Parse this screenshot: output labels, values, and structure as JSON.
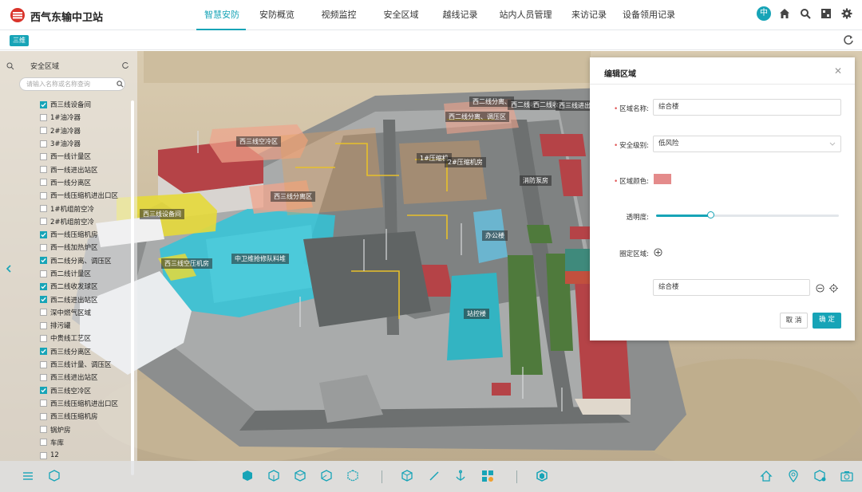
{
  "app": {
    "title": "西气东输中卫站"
  },
  "nav": {
    "items": [
      "智慧安防",
      "安防概览",
      "视频监控",
      "安全区域",
      "越线记录",
      "站内人员管理",
      "来访记录",
      "设备领用记录"
    ],
    "active": 0
  },
  "toolbar": {
    "lang": "中",
    "icons": [
      "home-icon",
      "search-icon",
      "fullscreen-icon",
      "settings-icon"
    ]
  },
  "subbar": {
    "mode_button": "三维"
  },
  "sidebar": {
    "title": "安全区域",
    "search_placeholder": "请输入名称或名称查询",
    "items": [
      {
        "label": "西三线设备间",
        "checked": true
      },
      {
        "label": "1#油冷器",
        "checked": false
      },
      {
        "label": "2#油冷器",
        "checked": false
      },
      {
        "label": "3#油冷器",
        "checked": false
      },
      {
        "label": "西一线计量区",
        "checked": false
      },
      {
        "label": "西一线进出站区",
        "checked": false
      },
      {
        "label": "西一线分离区",
        "checked": false
      },
      {
        "label": "西一线压缩机进出口区",
        "checked": false
      },
      {
        "label": "1#机组前空冷",
        "checked": false
      },
      {
        "label": "2#机组前空冷",
        "checked": false
      },
      {
        "label": "西一线压缩机房",
        "checked": true
      },
      {
        "label": "西一线加热炉区",
        "checked": false
      },
      {
        "label": "西二线分离、调压区",
        "checked": true
      },
      {
        "label": "西二线计量区",
        "checked": false
      },
      {
        "label": "西二线收发球区",
        "checked": true
      },
      {
        "label": "西二线进出站区",
        "checked": true
      },
      {
        "label": "深中燃气区域",
        "checked": false
      },
      {
        "label": "排污罐",
        "checked": false
      },
      {
        "label": "中贵线工艺区",
        "checked": false
      },
      {
        "label": "西三线分离区",
        "checked": true
      },
      {
        "label": "西三线计量、调压区",
        "checked": false
      },
      {
        "label": "西三线进出站区",
        "checked": false
      },
      {
        "label": "西三线空冷区",
        "checked": true
      },
      {
        "label": "西三线压缩机进出口区",
        "checked": false
      },
      {
        "label": "西三线压缩机房",
        "checked": false
      },
      {
        "label": "锅炉房",
        "checked": false
      },
      {
        "label": "车库",
        "checked": false
      },
      {
        "label": "12",
        "checked": false
      }
    ]
  },
  "scene_labels": [
    "西三线空冷区",
    "西三线分离区",
    "西三线设备间",
    "西三线空压机房",
    "中卫维抢修队料堆",
    "西二线分离、调压区",
    "西二线分离、",
    "西二线收",
    "西二线收",
    "西三线进出",
    "1#压缩机",
    "2#压缩机房",
    "消防泵房",
    "办公楼",
    "站控楼"
  ],
  "panel": {
    "title": "编辑区域",
    "name_label": "区域名称:",
    "name_value": "综合楼",
    "level_label": "安全级别:",
    "level_value": "低风险",
    "color_label": "区域颜色:",
    "color_value": "#e48b8b",
    "opacity_label": "透明度:",
    "opacity_value": 0.3,
    "area_label": "圈定区域:",
    "area_item": "综合楼",
    "cancel": "取 消",
    "confirm": "确 定"
  }
}
